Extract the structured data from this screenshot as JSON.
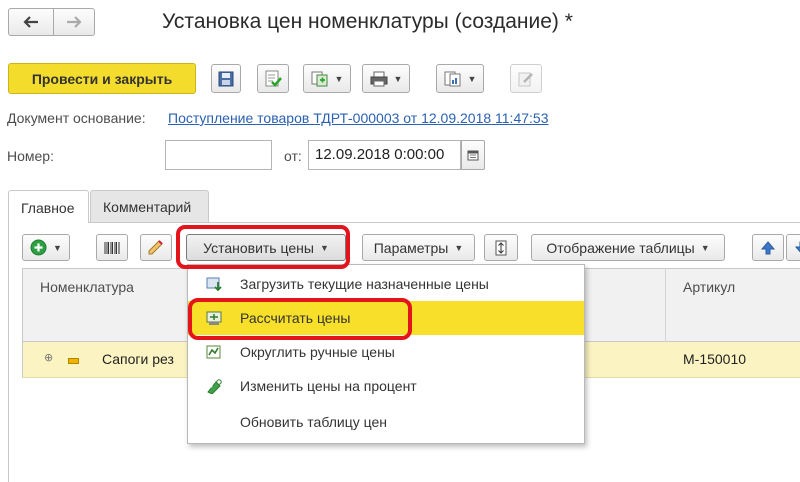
{
  "nav": {
    "back_icon": "arrow-left-icon",
    "forward_icon": "arrow-right-icon"
  },
  "title": "Установка цен номенклатуры (создание) *",
  "toolbar": {
    "post_close_label": "Провести и закрыть",
    "icons": [
      "save-icon",
      "post-doc-icon",
      "create-based-icon",
      "print-icon",
      "reports-icon",
      "edit-icon"
    ]
  },
  "form": {
    "base_doc_label": "Документ основание:",
    "base_doc_link": "Поступление товаров ТДРТ-000003 от 12.09.2018 11:47:53",
    "number_label": "Номер:",
    "number_value": "",
    "date_label": "от:",
    "date_value": "12.09.2018  0:00:00"
  },
  "tabs": [
    {
      "label": "Главное",
      "active": true
    },
    {
      "label": "Комментарий",
      "active": false
    }
  ],
  "table_toolbar": {
    "set_prices_label": "Установить цены",
    "parameters_label": "Параметры",
    "table_display_label": "Отображение таблицы"
  },
  "table": {
    "columns": [
      "Номенклатура",
      "Артикул"
    ],
    "rows": [
      {
        "name": "Сапоги рез",
        "article": "М-150010"
      }
    ]
  },
  "menu": {
    "items": [
      {
        "label": "Загрузить текущие назначенные цены",
        "highlighted": false
      },
      {
        "label": "Рассчитать цены",
        "highlighted": true
      },
      {
        "label": "Округлить ручные цены",
        "highlighted": false
      },
      {
        "label": "Изменить цены на процент",
        "highlighted": false
      },
      {
        "label": "Обновить таблицу цен",
        "highlighted": false
      }
    ]
  },
  "colors": {
    "primary_button": "#f3dc2c",
    "menu_highlight": "#f7df2a",
    "row_highlight": "#fbf4c2",
    "annotation_red": "#e3141b",
    "link_blue": "#2a61b3"
  }
}
